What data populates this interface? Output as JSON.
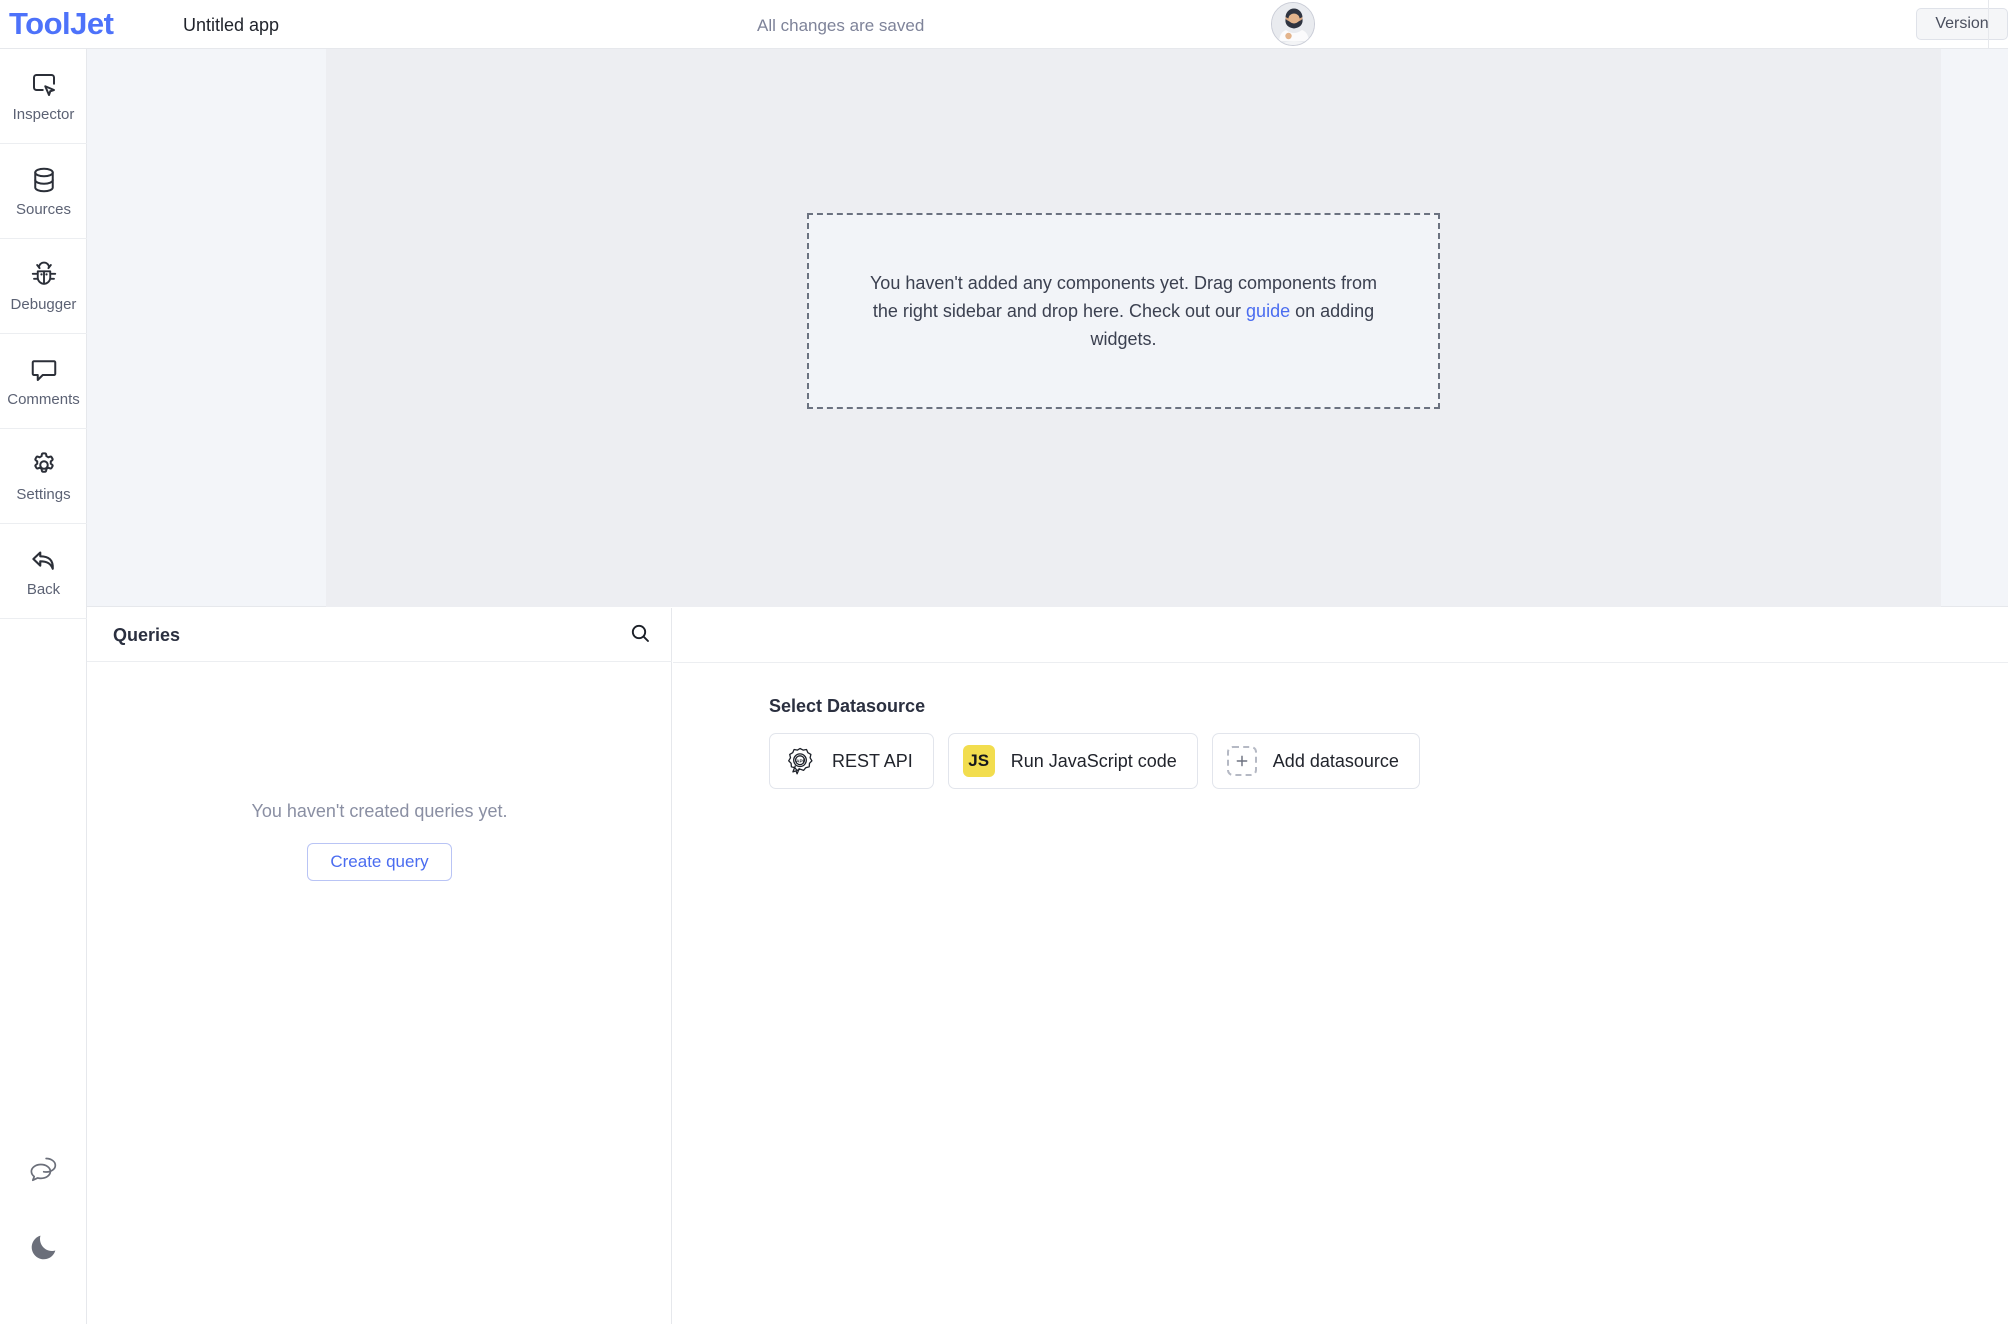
{
  "header": {
    "logo": "ToolJet",
    "app_title": "Untitled app",
    "save_status": "All changes are saved",
    "version_label": "Version",
    "avatar_name": "user-avatar"
  },
  "sidebar": {
    "items": [
      {
        "icon": "inspector-icon",
        "label": "Inspector"
      },
      {
        "icon": "database-icon",
        "label": "Sources"
      },
      {
        "icon": "bug-icon",
        "label": "Debugger"
      },
      {
        "icon": "comment-icon",
        "label": "Comments"
      },
      {
        "icon": "gear-icon",
        "label": "Settings"
      },
      {
        "icon": "back-arrow-icon",
        "label": "Back"
      }
    ],
    "bottom_icons": [
      {
        "icon": "chat-bubbles-icon"
      },
      {
        "icon": "moon-icon"
      }
    ]
  },
  "canvas": {
    "empty_text_before_link": "You haven't added any components yet. Drag components from the right sidebar and drop here. Check out our ",
    "empty_link": "guide",
    "empty_text_after_link": " on adding widgets."
  },
  "queries": {
    "title": "Queries",
    "search_icon": "search-icon",
    "add_icon": "plus-icon",
    "empty_message": "You haven't created queries yet.",
    "create_button": "Create query"
  },
  "datasource": {
    "title": "Select Datasource",
    "cards": [
      {
        "label": "REST API",
        "icon": "rest-api-icon"
      },
      {
        "label": "Run JavaScript code",
        "icon": "js-icon",
        "badge": "JS"
      },
      {
        "label": "Add datasource",
        "icon": "add-datasource-icon"
      }
    ]
  },
  "colors": {
    "brand": "#4d72fa",
    "link": "#4a6cf0",
    "js_yellow": "#f2dd4e",
    "canvas_bg": "#edeef2",
    "gutter_bg": "#f3f5f9"
  }
}
